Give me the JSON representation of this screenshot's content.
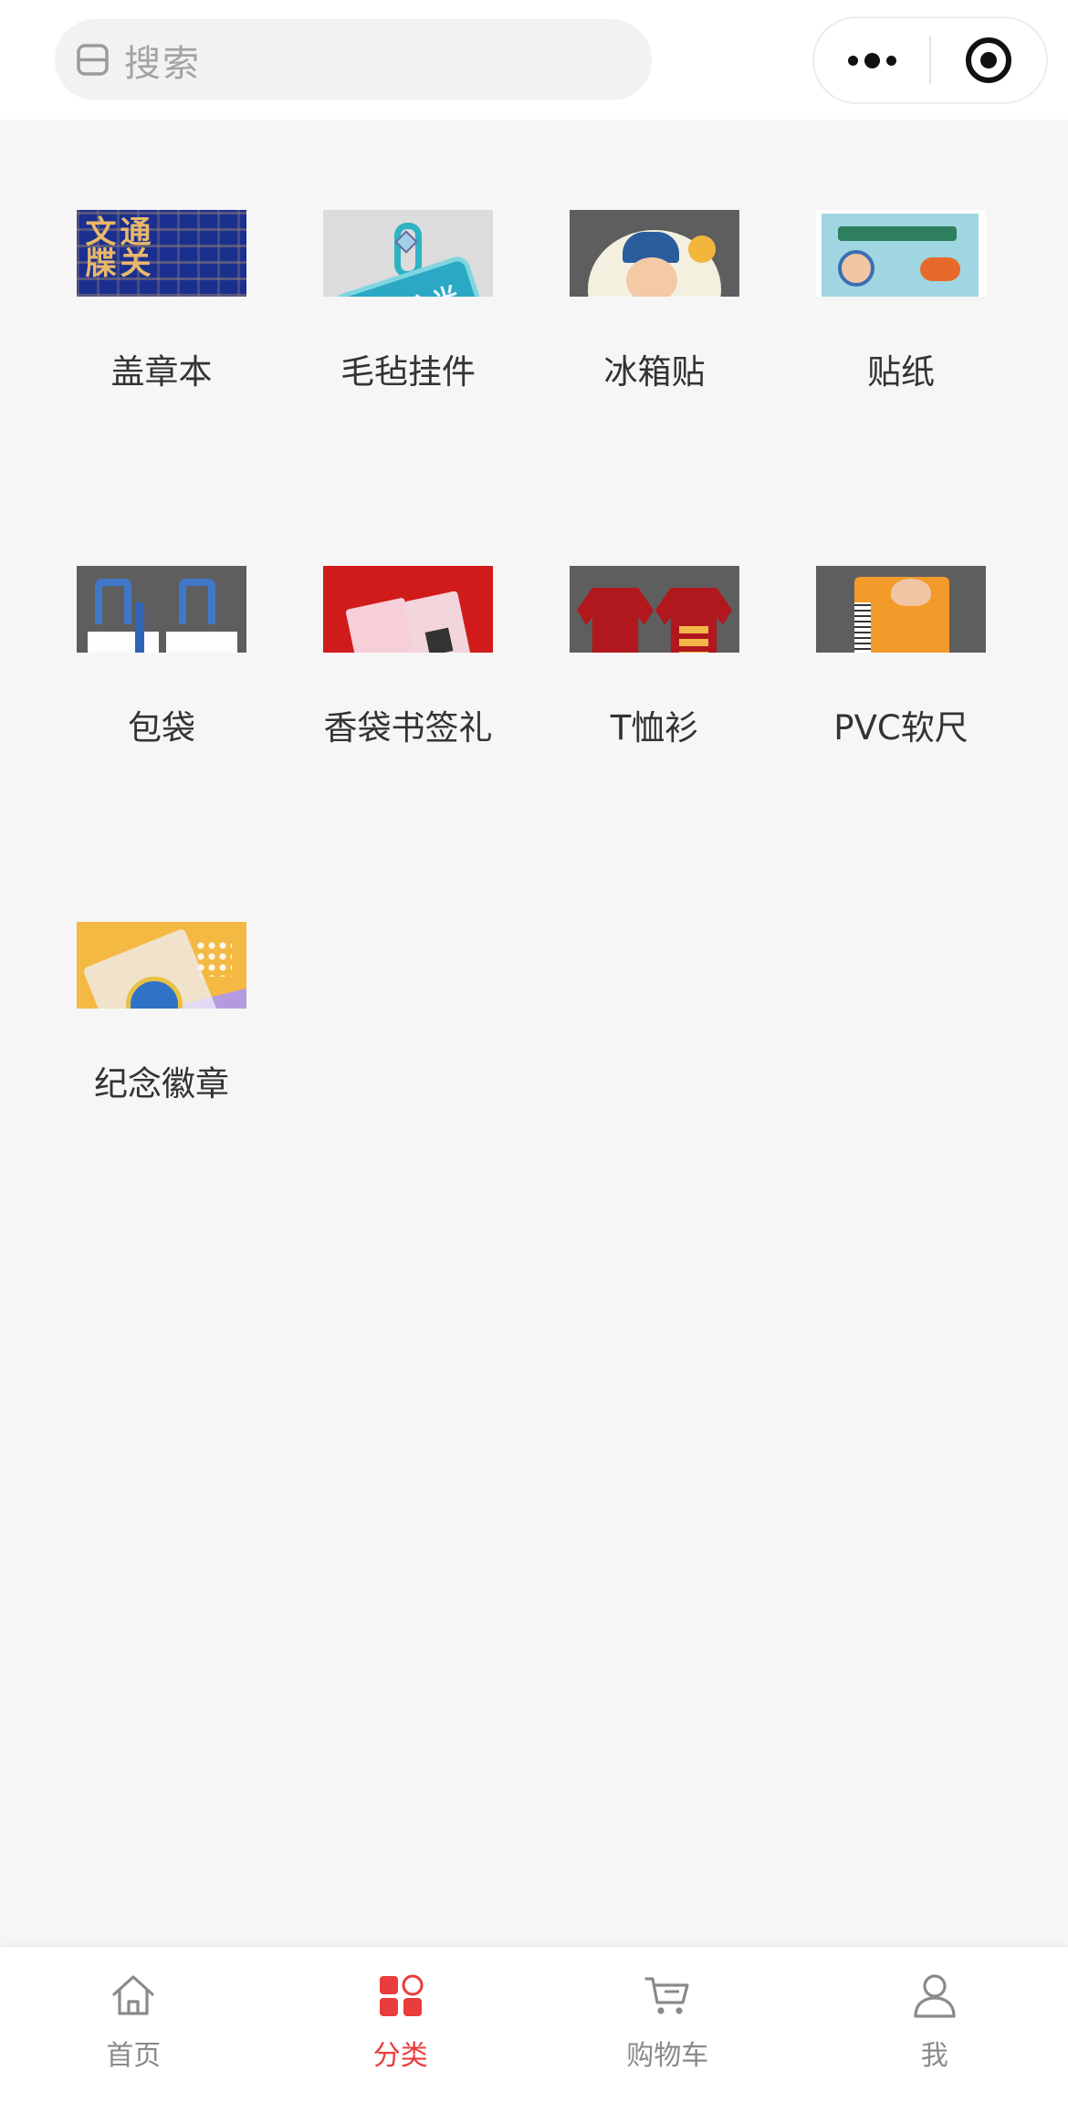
{
  "search": {
    "placeholder": "搜索"
  },
  "capsule": {
    "menu_icon": "more-dots-icon",
    "close_icon": "target-circle-icon"
  },
  "categories": [
    {
      "label": "盖章本",
      "icon": "notebook-thumbnail",
      "thumb_text": "通关文牒"
    },
    {
      "label": "毛毡挂件",
      "icon": "felt-pendant-thumbnail",
      "thumb_text": "成长之光"
    },
    {
      "label": "冰箱贴",
      "icon": "fridge-magnet-thumbnail"
    },
    {
      "label": "贴纸",
      "icon": "sticker-thumbnail"
    },
    {
      "label": "包袋",
      "icon": "tote-bag-thumbnail"
    },
    {
      "label": "香袋书签礼",
      "icon": "sachet-bookmark-thumbnail"
    },
    {
      "label": "T恤衫",
      "icon": "tshirt-thumbnail"
    },
    {
      "label": "PVC软尺",
      "icon": "pvc-ruler-thumbnail"
    },
    {
      "label": "纪念徽章",
      "icon": "commemorative-badge-thumbnail"
    }
  ],
  "tabbar": {
    "active_color": "#e93c3c",
    "inactive_color": "#8a8a8a",
    "items": [
      {
        "label": "首页",
        "icon": "home-icon"
      },
      {
        "label": "分类",
        "icon": "category-icon"
      },
      {
        "label": "购物车",
        "icon": "cart-icon"
      },
      {
        "label": "我",
        "icon": "user-icon"
      }
    ]
  }
}
